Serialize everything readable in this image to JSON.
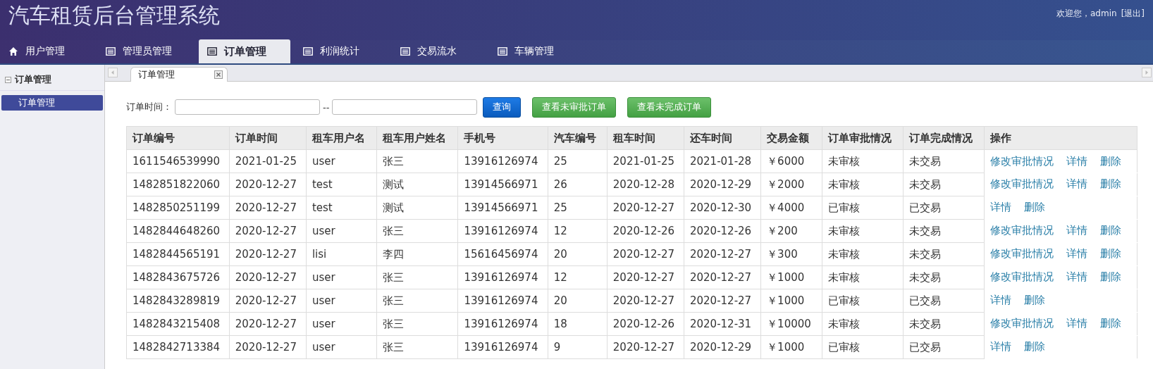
{
  "header": {
    "title": "汽车租赁后台管理系统",
    "welcome": "欢迎您，admin",
    "logout": "[退出]"
  },
  "nav_tabs": [
    {
      "label": "用户管理",
      "kind": "home",
      "selected": false
    },
    {
      "label": "管理员管理",
      "kind": "list",
      "selected": false
    },
    {
      "label": "订单管理",
      "kind": "list",
      "selected": true
    },
    {
      "label": "利润统计",
      "kind": "list",
      "selected": false
    },
    {
      "label": "交易流水",
      "kind": "list",
      "selected": false
    },
    {
      "label": "车辆管理",
      "kind": "list",
      "selected": false
    }
  ],
  "sidebar": {
    "heading": "订单管理",
    "items": [
      {
        "label": "订单管理",
        "selected": true
      }
    ]
  },
  "page_tab": {
    "label": "订单管理"
  },
  "filter": {
    "label": "订单时间：",
    "separator": "--",
    "buttons": [
      {
        "label": "查询",
        "kind": "primary"
      },
      {
        "label": "查看未审批订单",
        "kind": "success"
      },
      {
        "label": "查看未完成订单",
        "kind": "success"
      }
    ]
  },
  "table": {
    "columns": [
      "订单编号",
      "订单时间",
      "租车用户名",
      "租车用户姓名",
      "手机号",
      "汽车编号",
      "租车时间",
      "还车时间",
      "交易金额",
      "订单审批情况",
      "订单完成情况",
      "操作"
    ],
    "rows": [
      {
        "cells": [
          "1611546539990",
          "2021-01-25",
          "user",
          "张三",
          "13916126974",
          "25",
          "2021-01-25",
          "2021-01-28",
          "￥6000",
          "未审核",
          "未交易"
        ],
        "actions": [
          "修改审批情况",
          "详情",
          "删除"
        ]
      },
      {
        "cells": [
          "1482851822060",
          "2020-12-27",
          "test",
          "测试",
          "13914566971",
          "26",
          "2020-12-28",
          "2020-12-29",
          "￥2000",
          "未审核",
          "未交易"
        ],
        "actions": [
          "修改审批情况",
          "详情",
          "删除"
        ]
      },
      {
        "cells": [
          "1482850251199",
          "2020-12-27",
          "test",
          "测试",
          "13914566971",
          "25",
          "2020-12-27",
          "2020-12-30",
          "￥4000",
          "已审核",
          "已交易"
        ],
        "actions": [
          "详情",
          "删除"
        ]
      },
      {
        "cells": [
          "1482844648260",
          "2020-12-27",
          "user",
          "张三",
          "13916126974",
          "12",
          "2020-12-26",
          "2020-12-26",
          "￥200",
          "未审核",
          "未交易"
        ],
        "actions": [
          "修改审批情况",
          "详情",
          "删除"
        ]
      },
      {
        "cells": [
          "1482844565191",
          "2020-12-27",
          "lisi",
          "李四",
          "15616456974",
          "20",
          "2020-12-27",
          "2020-12-27",
          "￥300",
          "未审核",
          "未交易"
        ],
        "actions": [
          "修改审批情况",
          "详情",
          "删除"
        ]
      },
      {
        "cells": [
          "1482843675726",
          "2020-12-27",
          "user",
          "张三",
          "13916126974",
          "12",
          "2020-12-27",
          "2020-12-27",
          "￥1000",
          "未审核",
          "未交易"
        ],
        "actions": [
          "修改审批情况",
          "详情",
          "删除"
        ]
      },
      {
        "cells": [
          "1482843289819",
          "2020-12-27",
          "user",
          "张三",
          "13916126974",
          "20",
          "2020-12-27",
          "2020-12-27",
          "￥1000",
          "已审核",
          "已交易"
        ],
        "actions": [
          "详情",
          "删除"
        ]
      },
      {
        "cells": [
          "1482843215408",
          "2020-12-27",
          "user",
          "张三",
          "13916126974",
          "18",
          "2020-12-26",
          "2020-12-31",
          "￥10000",
          "未审核",
          "未交易"
        ],
        "actions": [
          "修改审批情况",
          "详情",
          "删除"
        ]
      },
      {
        "cells": [
          "1482842713384",
          "2020-12-27",
          "user",
          "张三",
          "13916126974",
          "9",
          "2020-12-27",
          "2020-12-29",
          "￥1000",
          "已审核",
          "已交易"
        ],
        "actions": [
          "详情",
          "删除"
        ]
      }
    ]
  }
}
